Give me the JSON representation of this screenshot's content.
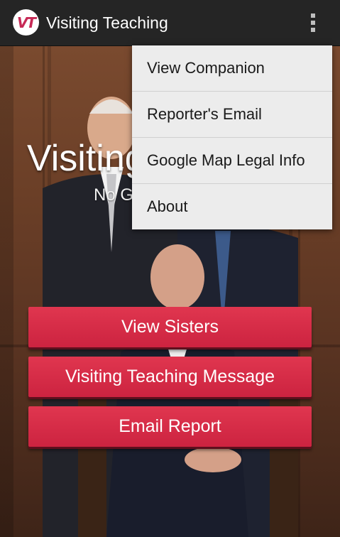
{
  "action_bar": {
    "logo_text": "VT",
    "title": "Visiting Teaching"
  },
  "banner": {
    "title": "Visiting Teaching",
    "subtitle": "No Geographic..."
  },
  "buttons": [
    {
      "label": "View Sisters"
    },
    {
      "label": "Visiting Teaching Message"
    },
    {
      "label": "Email Report"
    }
  ],
  "overflow_menu": {
    "items": [
      {
        "label": "View Companion"
      },
      {
        "label": "Reporter's Email"
      },
      {
        "label": "Google Map Legal Info"
      },
      {
        "label": "About"
      }
    ]
  },
  "colors": {
    "action_bar": "#252525",
    "button": "#d42b46",
    "menu_bg": "#ececec",
    "logo_accent": "#c72a56"
  }
}
